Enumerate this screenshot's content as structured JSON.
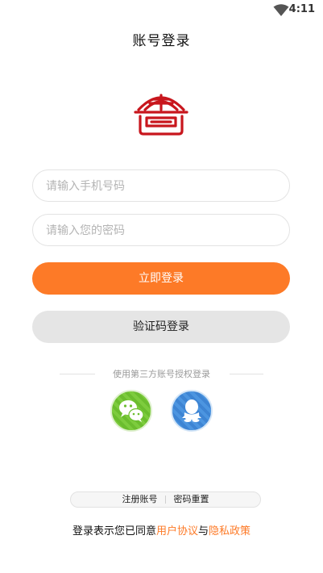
{
  "status_bar": {
    "time": "4:11",
    "wifi_icon": "wifi-icon"
  },
  "header": {
    "title": "账号登录"
  },
  "logo": {
    "icon": "app-logo-icon",
    "color": "#c8161d"
  },
  "form": {
    "phone_placeholder": "请输入手机号码",
    "phone_value": "",
    "password_placeholder": "请输入您的密码",
    "password_value": ""
  },
  "buttons": {
    "login_label": "立即登录",
    "code_login_label": "验证码登录"
  },
  "third_party": {
    "label": "使用第三方账号授权登录",
    "wechat_icon": "wechat-icon",
    "qq_icon": "qq-icon"
  },
  "links": {
    "register": "注册账号",
    "reset_password": "密码重置"
  },
  "agreement": {
    "prefix": "登录表示您已同意",
    "user_agreement": "用户协议",
    "conjunction": "与",
    "privacy_policy": "隐私政策"
  },
  "colors": {
    "accent": "#fd7a27",
    "secondary_button": "#e5e5e5",
    "wechat": "#6bbd2e",
    "qq": "#3d84d3"
  }
}
